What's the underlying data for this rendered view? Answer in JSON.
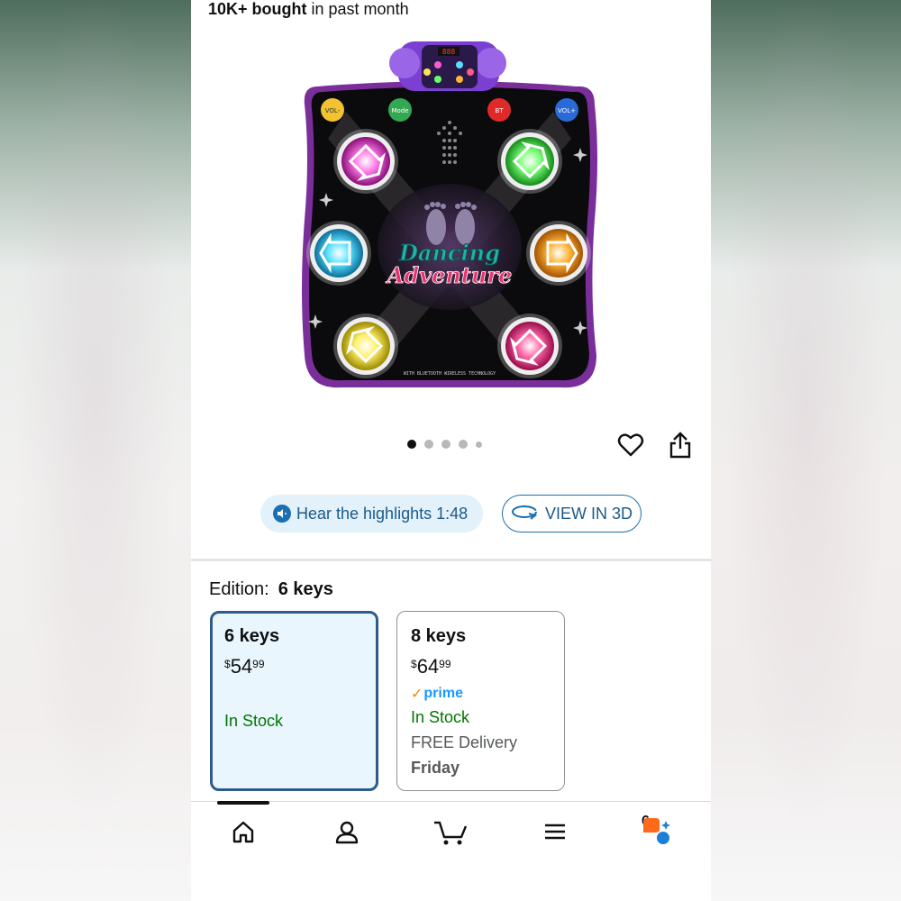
{
  "header": {
    "bought_bold": "10K+ bought",
    "bought_rest": " in past month"
  },
  "product_image": {
    "mat_title_line1": "Dancing",
    "mat_title_line2": "Adventure",
    "mat_buttons": [
      "VOL-",
      "Mode",
      "BT",
      "VOL+"
    ],
    "mat_footer": "WITH BLUETOOTH WIRELESS TECHNOLOGY",
    "console_display": "888"
  },
  "gallery": {
    "dot_count": 5,
    "active_index": 0
  },
  "actions": {
    "hear_label": "Hear the highlights 1:48",
    "view3d_label": "VIEW IN 3D"
  },
  "edition": {
    "label": "Edition:",
    "selected": "6 keys",
    "options": [
      {
        "title": "6 keys",
        "symbol": "$",
        "whole": "54",
        "fraction": "99",
        "stock": "In Stock"
      },
      {
        "title": "8 keys",
        "symbol": "$",
        "whole": "64",
        "fraction": "99",
        "prime": "prime",
        "stock": "In Stock",
        "delivery": "FREE Delivery",
        "delivery_day": "Friday"
      }
    ]
  },
  "tabbar": {
    "tabs": [
      "home-icon",
      "account-icon",
      "cart-icon",
      "menu-icon",
      "rufus-icon"
    ],
    "cart_count": "6"
  },
  "colors": {
    "link_blue": "#1b5a8a",
    "selected_border": "#2e5b8b",
    "stock_green": "#007600",
    "prime_blue": "#1a98ff"
  }
}
